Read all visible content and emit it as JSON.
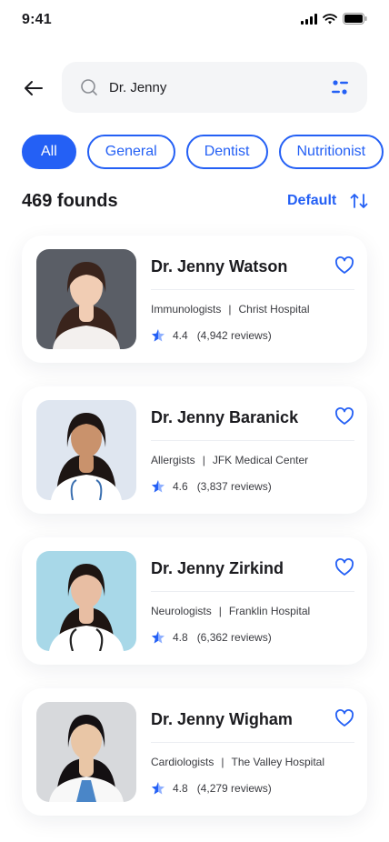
{
  "status_bar": {
    "time": "9:41"
  },
  "search": {
    "value": "Dr. Jenny"
  },
  "filters": [
    "All",
    "General",
    "Dentist",
    "Nutritionist"
  ],
  "results": {
    "count_label": "469 founds",
    "sort_label": "Default"
  },
  "doctors": [
    {
      "name": "Dr. Jenny Watson",
      "specialty": "Immunologists",
      "hospital": "Christ Hospital",
      "rating": "4.4",
      "reviews": "(4,942 reviews)",
      "photo_bg": "#5a5e66",
      "skin": "#f1cdb4",
      "hair": "#3a241c",
      "coat": "#f3f0ee"
    },
    {
      "name": "Dr. Jenny Baranick",
      "specialty": "Allergists",
      "hospital": "JFK Medical Center",
      "rating": "4.6",
      "reviews": "(3,837 reviews)",
      "photo_bg": "#dfe6f0",
      "skin": "#c9926c",
      "hair": "#1d1513",
      "coat": "#ffffff"
    },
    {
      "name": "Dr. Jenny Zirkind",
      "specialty": "Neurologists",
      "hospital": "Franklin Hospital",
      "rating": "4.8",
      "reviews": "(6,362 reviews)",
      "photo_bg": "#a8d8e8",
      "skin": "#e8bea3",
      "hair": "#1e1512",
      "coat": "#ffffff"
    },
    {
      "name": "Dr. Jenny Wigham",
      "specialty": "Cardiologists",
      "hospital": "The Valley Hospital",
      "rating": "4.8",
      "reviews": "(4,279 reviews)",
      "photo_bg": "#d7d9dc",
      "skin": "#e9c6a6",
      "hair": "#141012",
      "coat": "#f8f8f8"
    }
  ],
  "colors": {
    "accent": "#2460f5",
    "text": "#1b1b1f",
    "muted": "#3a3b40"
  }
}
